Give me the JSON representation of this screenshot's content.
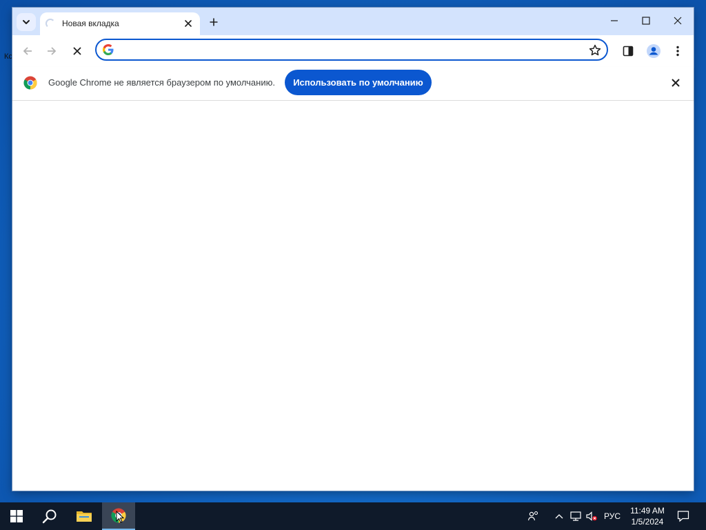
{
  "desktop": {
    "edge_label": "Кс"
  },
  "browser": {
    "tab": {
      "title": "Новая вкладка"
    },
    "omnibox": {
      "value": "",
      "placeholder": ""
    },
    "infobar": {
      "message": "Google Chrome не является браузером по умолчанию.",
      "button_label": "Использовать по умолчанию"
    }
  },
  "taskbar": {
    "language": "РУС",
    "time": "11:49 AM",
    "date": "1/5/2024"
  },
  "colors": {
    "titlebar": "#d3e3fd",
    "accent": "#0b57d0",
    "taskbar": "#0f1a2a"
  }
}
